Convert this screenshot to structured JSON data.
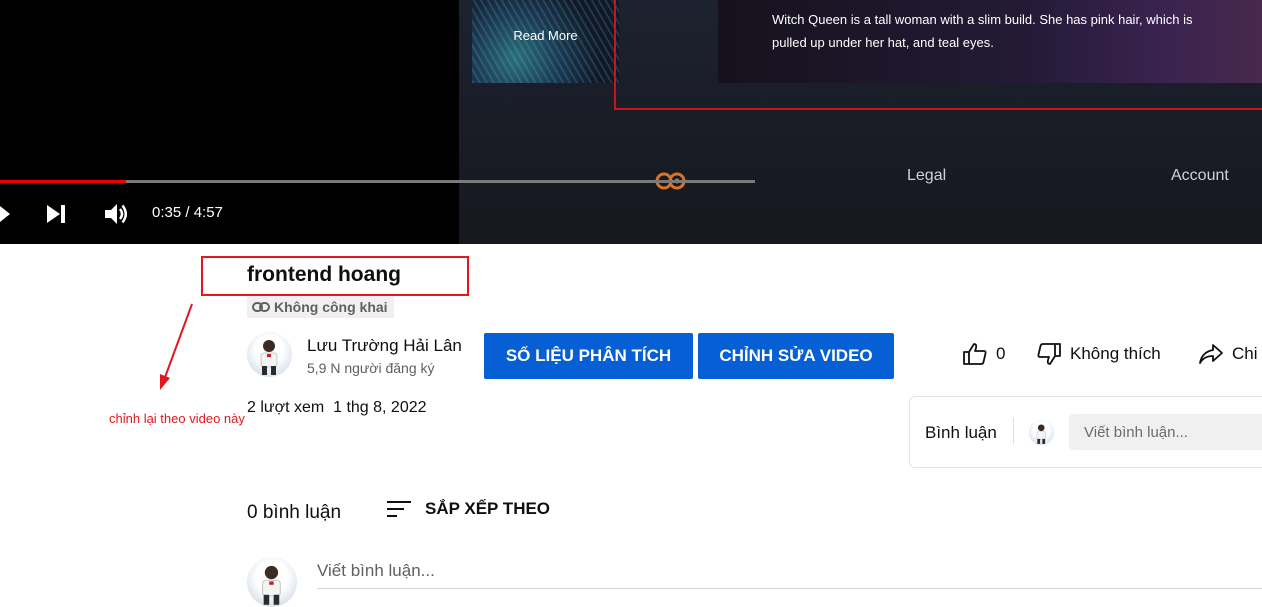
{
  "player": {
    "read_more": "Read More",
    "card_text": "Witch Queen is a tall woman with a slim build. She has pink hair, which is pulled up under her hat, and teal eyes.",
    "footer_mid": "Legal",
    "footer_right": "Account",
    "time": "0:35 / 4:57",
    "progress_fraction": 0.167,
    "accent": "#e00000"
  },
  "video": {
    "title": "frontend hoang",
    "privacy": "Không công khai",
    "channel_name": "Lưu Trường Hải Lân",
    "subscribers": "5,9 N người đăng ký",
    "analytics_button": "SỐ LIỆU PHÂN TÍCH",
    "edit_button": "CHỈNH SỬA VIDEO",
    "like_count": "0",
    "dislike_label": "Không thích",
    "share_label": "Chi",
    "views": "2 lượt xem",
    "date": "1 thg 8, 2022",
    "brand_blue": "#065fd4"
  },
  "annotation": {
    "note": "chỉnh lại theo video này",
    "color": "#e0191f"
  },
  "comments_panel": {
    "title": "Bình luận",
    "placeholder": "Viết bình luận..."
  },
  "comments": {
    "count": "0 bình luận",
    "sort_label": "SẮP XẾP THEO",
    "placeholder": "Viết bình luận..."
  }
}
